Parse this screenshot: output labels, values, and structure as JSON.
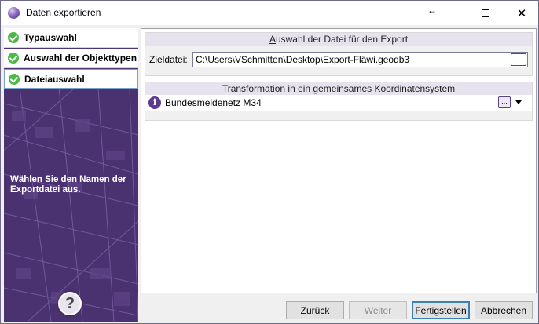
{
  "window": {
    "title": "Daten exportieren",
    "close_glyph": "✕",
    "resize_glyph": "↔"
  },
  "steps": [
    {
      "label": "Typauswahl",
      "state": "done"
    },
    {
      "label": "Auswahl der Objekttypen",
      "state": "done"
    },
    {
      "label": "Dateiauswahl",
      "state": "active"
    }
  ],
  "left_panel": {
    "hint": "Wählen Sie den Namen der Exportdatei aus.",
    "help_glyph": "?"
  },
  "file_group": {
    "header_mnemonic": "A",
    "header_rest": "uswahl der Datei für den Export",
    "label_mnemonic": "Z",
    "label_rest": "ieldatei:",
    "value": "C:\\Users\\VSchmitten\\Desktop\\Export-Fläwi.geodb3"
  },
  "crs_group": {
    "header_mnemonic": "T",
    "header_rest": "ransformation in ein gemeinsames Koordinatensystem",
    "selected": "Bundesmeldenetz M34",
    "info_glyph": "i",
    "dots_label": "..."
  },
  "buttons": {
    "back_mnemonic": "Z",
    "back_rest": "urück",
    "next": "Weiter",
    "finish_mnemonic": "F",
    "finish_rest": "ertigstellen",
    "cancel_mnemonic": "A",
    "cancel_rest": "bbrechen"
  },
  "colors": {
    "accent_purple": "#4d3474",
    "check_green": "#4cb848",
    "primary_border": "#3c7fb1"
  }
}
